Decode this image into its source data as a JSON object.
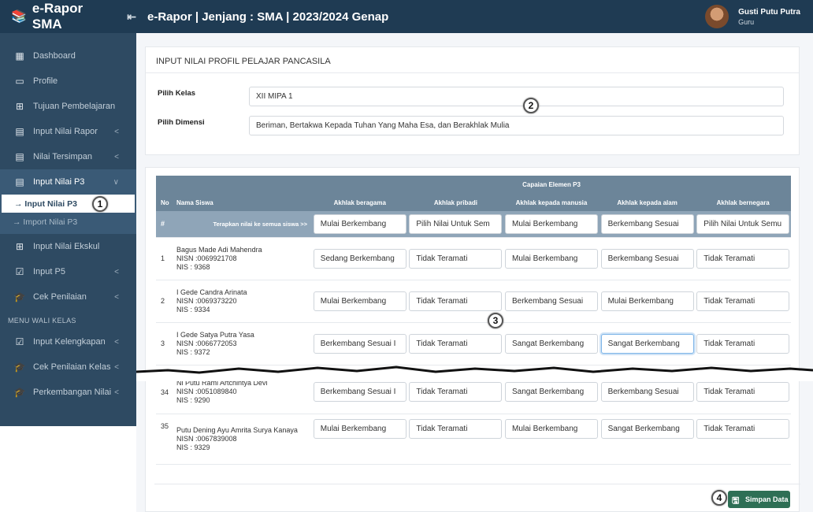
{
  "app": {
    "brand": "e-Rapor SMA",
    "collapse_icon": "sidebar-collapse-icon"
  },
  "topbar": {
    "title": "e-Rapor | Jenjang : SMA | 2023/2024 Genap"
  },
  "user": {
    "name": "Gusti Putu Putra",
    "role": "Guru"
  },
  "sidebar": {
    "items": [
      {
        "label": "Dashboard",
        "icon": "dashboard-icon"
      },
      {
        "label": "Profile",
        "icon": "profile-icon"
      },
      {
        "label": "Tujuan Pembelajaran",
        "icon": "plus-square-icon"
      },
      {
        "label": "Input Nilai Rapor",
        "icon": "form-icon",
        "chevron": "<"
      },
      {
        "label": "Nilai Tersimpan",
        "icon": "form-icon",
        "chevron": "<"
      },
      {
        "label": "Input Nilai P3",
        "icon": "form-icon",
        "chevron": "∨"
      }
    ],
    "submenu": [
      {
        "label": "→ Input Nilai P3"
      },
      {
        "label": "→ Import Nilai P3"
      }
    ],
    "items2": [
      {
        "label": "Input Nilai Ekskul",
        "icon": "plus-square-icon"
      },
      {
        "label": "Input P5",
        "icon": "check-square-icon",
        "chevron": "<"
      },
      {
        "label": "Cek Penilaian",
        "icon": "graduation-cap-icon",
        "chevron": "<"
      }
    ],
    "section": "MENU WALI KELAS",
    "items3": [
      {
        "label": "Input Kelengkapan",
        "icon": "check-square-icon",
        "chevron": "<"
      },
      {
        "label": "Cek Penilaian Kelas",
        "icon": "graduation-cap-icon",
        "chevron": "<"
      },
      {
        "label": "Perkembangan Nilai",
        "icon": "graduation-cap-icon",
        "chevron": "<"
      }
    ]
  },
  "form": {
    "title": "INPUT NILAI PROFIL PELAJAR PANCASILA",
    "kelas_label": "Pilih Kelas",
    "kelas_value": "XII MIPA 1",
    "dimensi_label": "Pilih Dimensi",
    "dimensi_value": "Beriman, Bertakwa Kepada Tuhan Yang Maha Esa, dan Berakhlak Mulia"
  },
  "table": {
    "group_header": "Capaian Elemen P3",
    "headers": {
      "no": "No",
      "name": "Nama Siswa",
      "c1": "Akhlak beragama",
      "c2": "Akhlak pribadi",
      "c3": "Akhlak kepada manusia",
      "c4": "Akhlak kepada alam",
      "c5": "Akhlak bernegara"
    },
    "apply": {
      "hash": "#",
      "label": "Terapkan nilai ke semua siswa >>",
      "v": [
        "Mulai Berkembang",
        "Pilih Nilai Untuk Sem",
        "Mulai Berkembang",
        "Berkembang Sesuai",
        "Pilih Nilai Untuk Semu"
      ]
    },
    "rows": [
      {
        "no": "1",
        "name": "Bagus Made Adi Mahendra",
        "nisn": "NISN :0069921708",
        "nis": "NIS : 9368",
        "v": [
          "Sedang Berkembang",
          "Tidak Teramati",
          "Mulai Berkembang",
          "Berkembang Sesuai",
          "Tidak Teramati"
        ]
      },
      {
        "no": "2",
        "name": "I Gede Candra Arinata",
        "nisn": "NISN :0069373220",
        "nis": "NIS : 9334",
        "v": [
          "Mulai Berkembang",
          "Tidak Teramati",
          "Berkembang Sesuai",
          "Mulai Berkembang",
          "Tidak Teramati"
        ]
      },
      {
        "no": "3",
        "name": "I Gede Satya Putra Yasa",
        "nisn": "NISN :0066772053",
        "nis": "NIS : 9372",
        "v": [
          "Berkembang Sesuai I",
          "Tidak Teramati",
          "Sangat Berkembang",
          "Sangat Berkembang",
          "Tidak Teramati"
        ]
      },
      {
        "no": "34",
        "name": "Ni Putu Rami Artchintya Devi",
        "nisn": "NISN :0051089840",
        "nis": "NIS : 9290",
        "v": [
          "Berkembang Sesuai I",
          "Tidak Teramati",
          "Sangat Berkembang",
          "Berkembang Sesuai",
          "Tidak Teramati"
        ]
      },
      {
        "no": "35",
        "name": "Putu Dening Ayu Amrita Surya Kanaya",
        "nisn": "NISN :0067839008",
        "nis": "NIS : 9329",
        "v": [
          "Mulai Berkembang",
          "Tidak Teramati",
          "Mulai Berkembang",
          "Sangat Berkembang",
          "Tidak Teramati"
        ]
      }
    ]
  },
  "save_label": "Simpan Data",
  "callouts": [
    "1",
    "2",
    "3",
    "4"
  ],
  "colors": {
    "sidebar": "#2e4a62",
    "topbar": "#1f3b53",
    "table_header": "#6c8599",
    "apply_row": "#8fa5b8",
    "save_button": "#2e6f55"
  }
}
